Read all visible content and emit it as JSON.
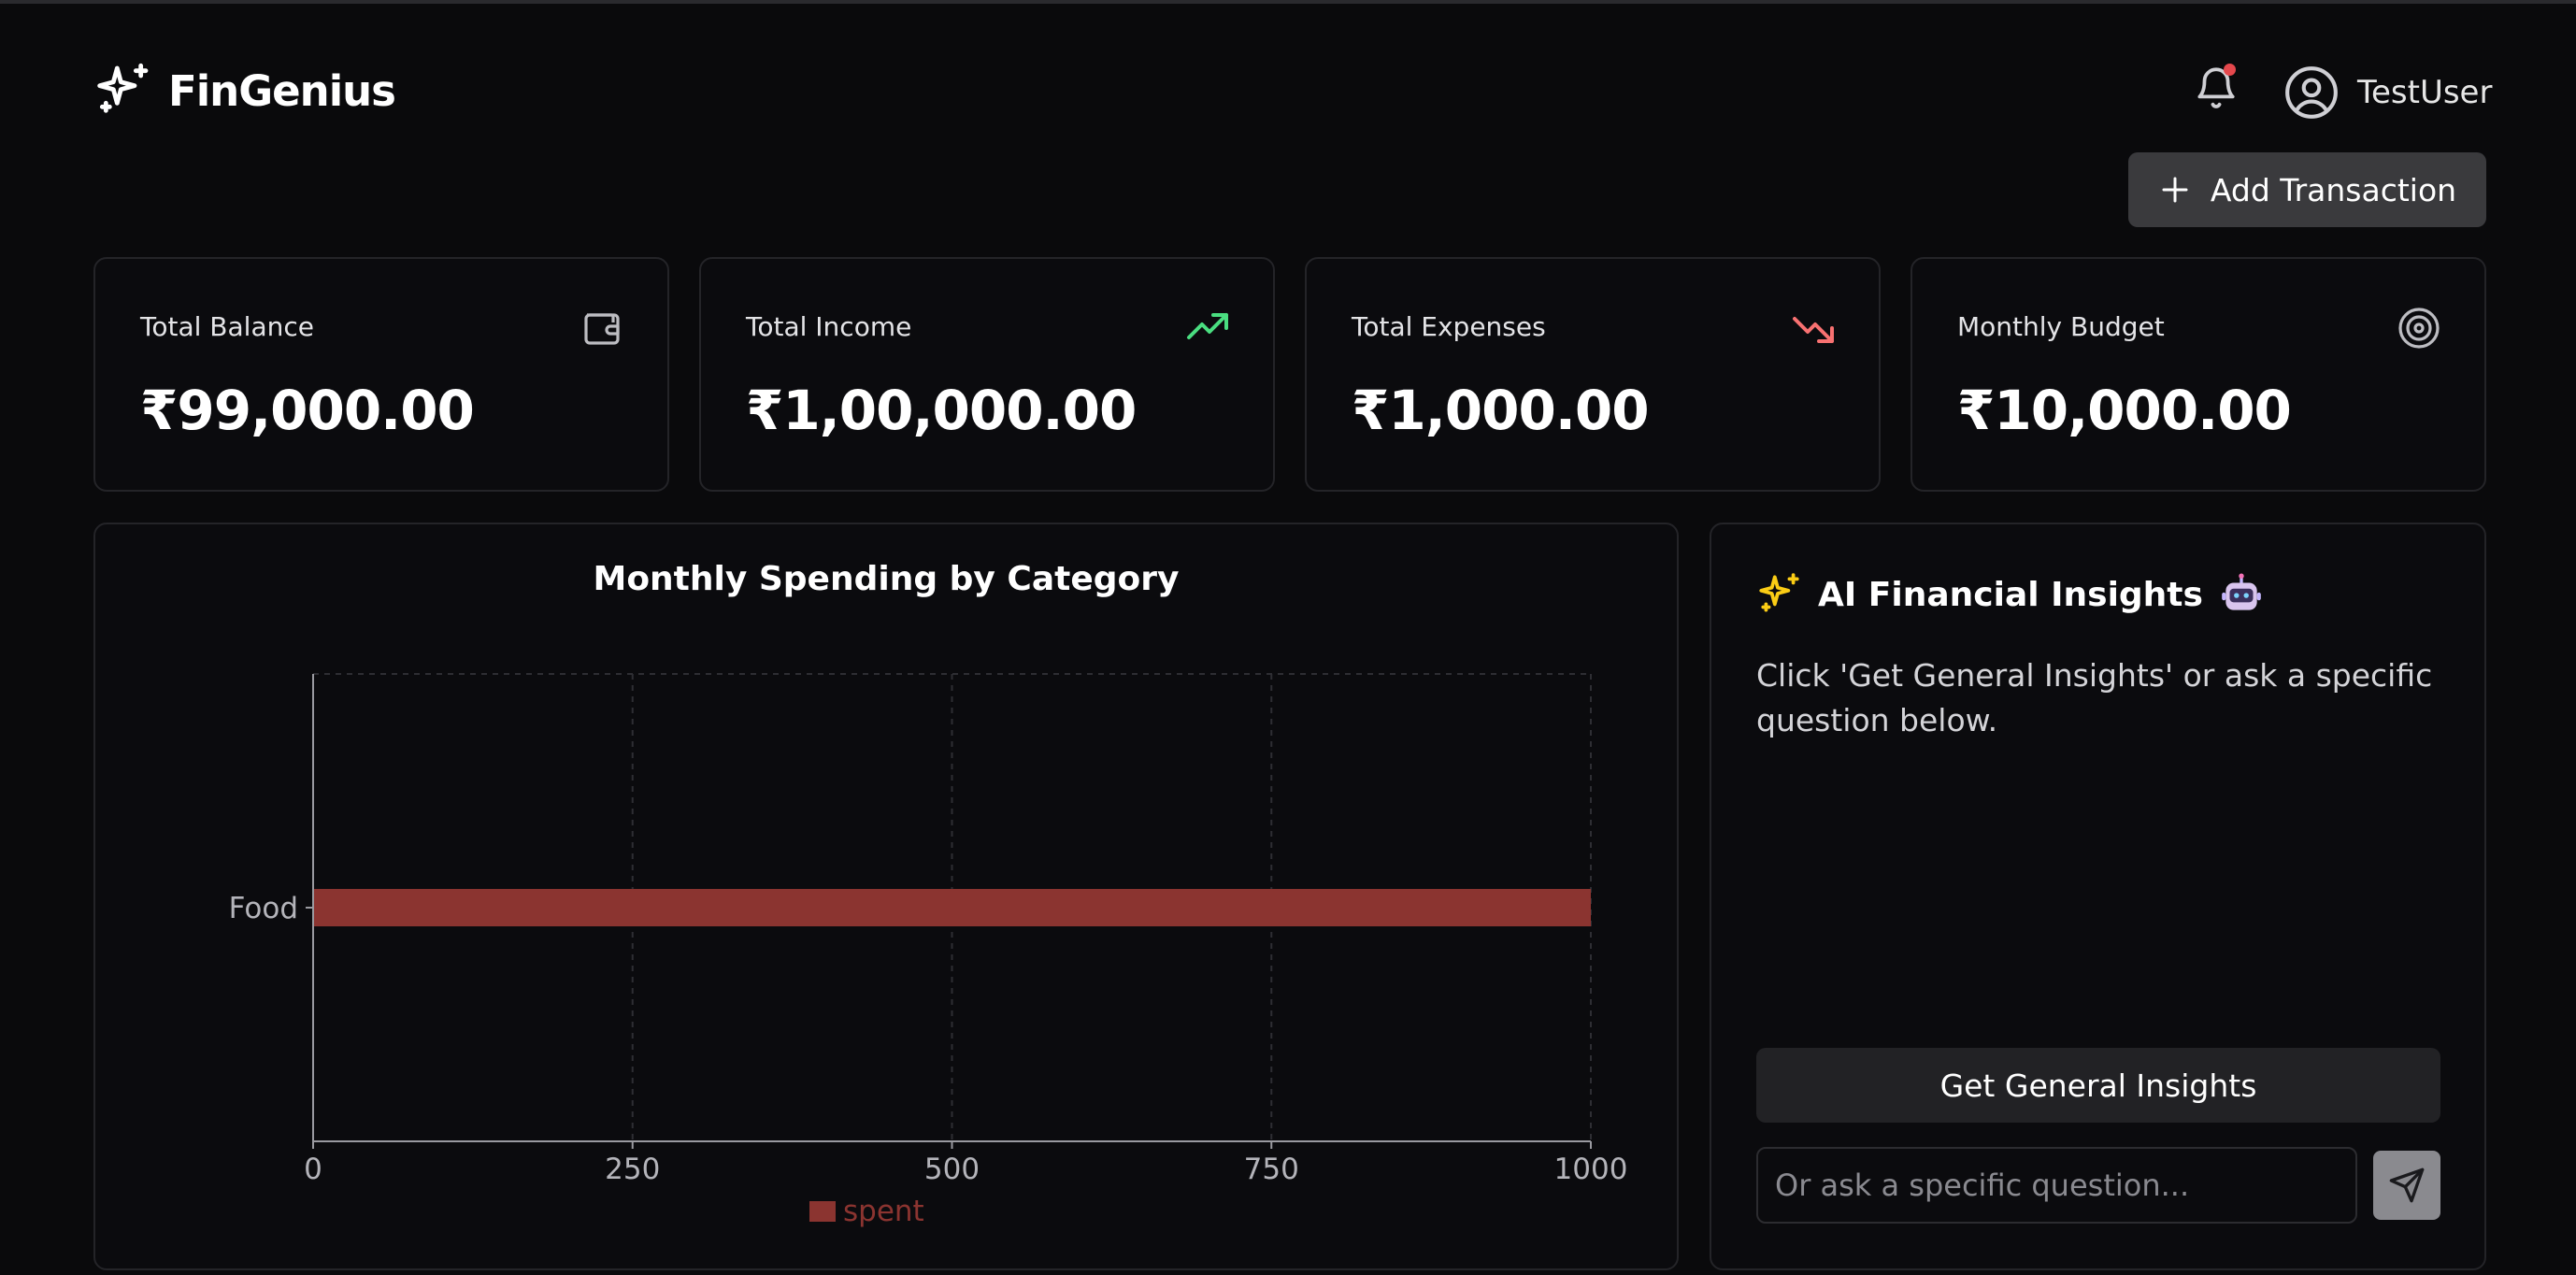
{
  "header": {
    "brand_name": "FinGenius",
    "user_name": "TestUser",
    "add_button_label": "Add Transaction"
  },
  "cards": [
    {
      "label": "Total Balance",
      "value": "₹99,000.00",
      "icon": "wallet-icon"
    },
    {
      "label": "Total Income",
      "value": "₹1,00,000.00",
      "icon": "trending-up-icon",
      "icon_color": "#4ade80"
    },
    {
      "label": "Total Expenses",
      "value": "₹1,000.00",
      "icon": "trending-down-icon",
      "icon_color": "#f87171"
    },
    {
      "label": "Monthly Budget",
      "value": "₹10,000.00",
      "icon": "target-icon"
    }
  ],
  "chart_data": {
    "type": "bar",
    "orientation": "horizontal",
    "title": "Monthly Spending by Category",
    "categories": [
      "Food"
    ],
    "series": [
      {
        "name": "spent",
        "values": [
          1000
        ],
        "color": "#8b3430"
      }
    ],
    "xlim": [
      0,
      1000
    ],
    "x_ticks": [
      0,
      250,
      500,
      750,
      1000
    ],
    "grid": true,
    "legend": "bottom-center"
  },
  "insights": {
    "title": "AI Financial Insights",
    "description": "Click 'Get General Insights' or ask a specific question below.",
    "button_label": "Get General Insights",
    "input_placeholder": "Or ask a specific question...",
    "input_value": ""
  },
  "colors": {
    "background": "#0a0a0c",
    "card_border": "#242428",
    "income_green": "#4ade80",
    "expense_red": "#f87171",
    "bar_red": "#8b3430",
    "sparkle_yellow": "#facc15"
  }
}
